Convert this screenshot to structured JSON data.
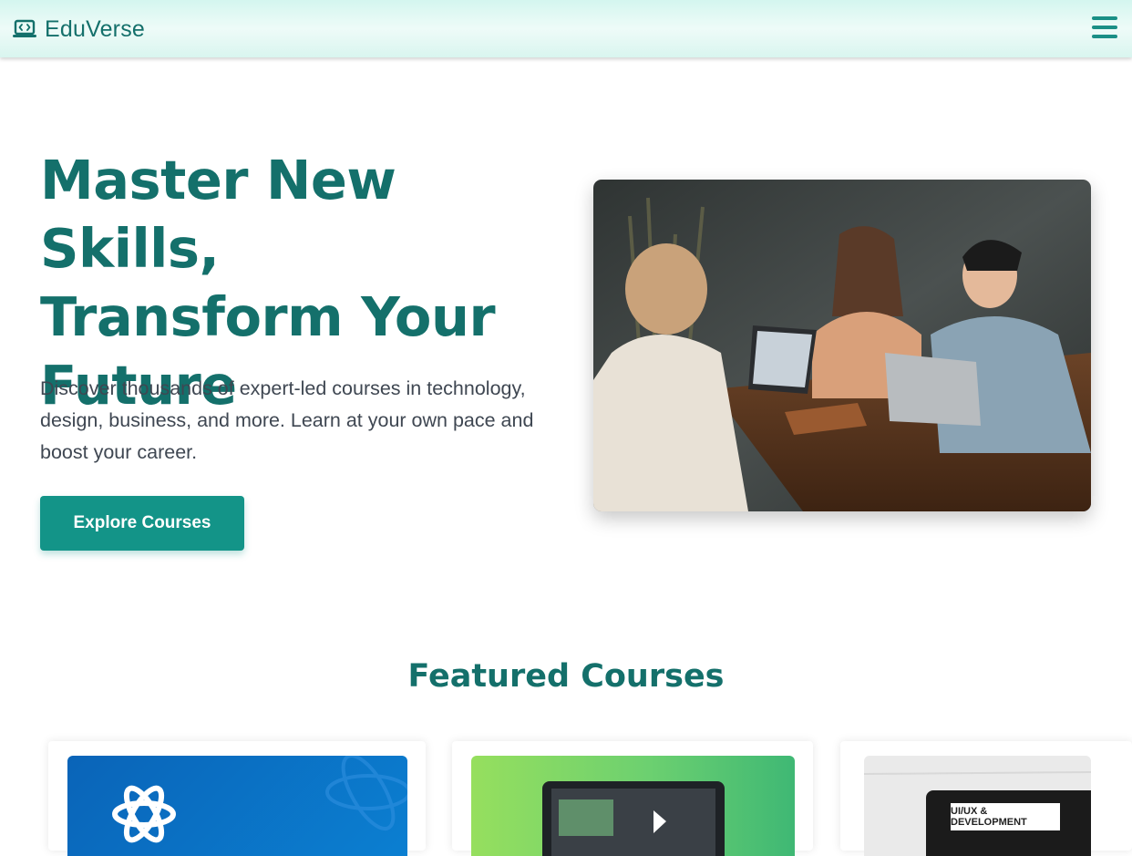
{
  "header": {
    "brand_name": "EduVerse",
    "logo_icon": "laptop-code-icon",
    "menu_icon": "hamburger-menu-icon"
  },
  "hero": {
    "title_line1": "Master New Skills,",
    "title_line2": "Transform Your",
    "title_line3": "Future",
    "subtitle": "Discover thousands of expert-led courses in technology, design, business, and more. Learn at your own pace and boost your career.",
    "cta_label": "Explore Courses",
    "image_alt": "Students collaborating with laptops at a cafe table"
  },
  "featured": {
    "title": "Featured Courses",
    "cards": [
      {
        "thumb_icon": "react-atom-icon"
      },
      {
        "thumb_icon": "video-play-icon"
      },
      {
        "thumb_badge": "UI/UX & DEVELOPMENT"
      }
    ]
  },
  "colors": {
    "brand": "#14706b",
    "accent": "#139488",
    "header_bg": "#e3f8f3",
    "text": "#3f4752"
  }
}
